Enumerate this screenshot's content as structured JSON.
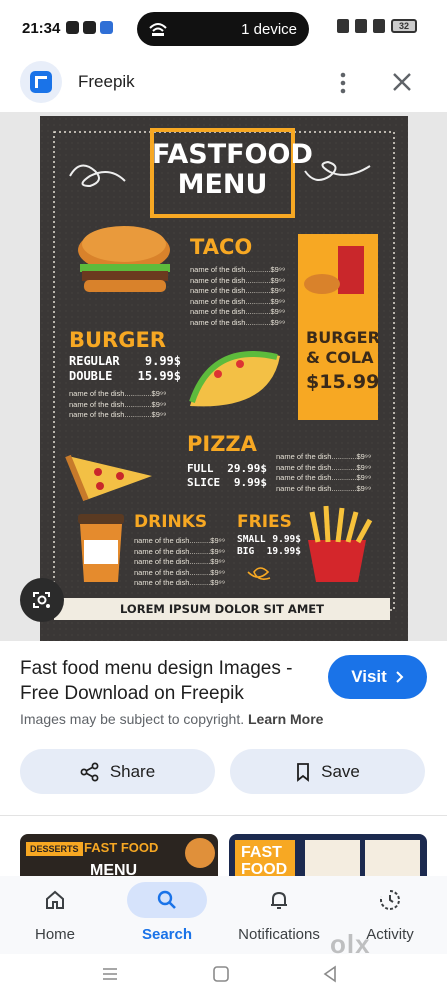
{
  "status": {
    "time": "21:34",
    "pill_text": "1 device",
    "battery": "32"
  },
  "source": {
    "name": "Freepik"
  },
  "menu_image": {
    "title_line1": "FASTFOOD",
    "title_line2": "MENU",
    "taco": {
      "heading": "TACO",
      "items": [
        "name of the dish............$9⁹⁹",
        "name of the dish............$9⁹⁹",
        "name of the dish............$9⁹⁹",
        "name of the dish............$9⁹⁹",
        "name of the dish............$9⁹⁹",
        "name of the dish............$9⁹⁹"
      ]
    },
    "burger": {
      "heading": "BURGER",
      "regular": "REGULAR",
      "regular_price": "9.99$",
      "double": "DOUBLE",
      "double_price": "15.99$",
      "items": [
        "name of the dish.............$9⁹⁹",
        "name of the dish.............$9⁹⁹",
        "name of the dish.............$9⁹⁹"
      ]
    },
    "combo": {
      "line1": "BURGER",
      "line2": "& COLA",
      "price": "$15.99"
    },
    "pizza": {
      "heading": "PIZZA",
      "full": "FULL",
      "full_price": "29.99$",
      "slice": "SLICE",
      "slice_price": "9.99$",
      "items": [
        "name of the dish............$9⁹⁹",
        "name of the dish............$9⁹⁹",
        "name of the dish............$9⁹⁹",
        "name of the dish............$9⁹⁹"
      ]
    },
    "drinks": {
      "heading": "DRINKS",
      "items": [
        "name of the dish..........$9⁹⁹",
        "name of the dish..........$9⁹⁹",
        "name of the dish..........$9⁹⁹",
        "name of the dish..........$9⁹⁹",
        "name of the dish..........$9⁹⁹"
      ]
    },
    "fries": {
      "heading": "FRIES",
      "small": "SMALL",
      "small_price": "9.99$",
      "big": "BIG",
      "big_price": "19.99$"
    },
    "footer": "LOREM IPSUM DOLOR SIT AMET"
  },
  "result": {
    "title": "Fast food menu design Images - Free Download on Freepik",
    "visit_label": "Visit",
    "copyright_text": "Images may be subject to copyright.",
    "learn_more": "Learn More",
    "share_label": "Share",
    "save_label": "Save"
  },
  "thumbs": {
    "thumb1_a": "DESSERTS",
    "thumb1_b": "FAST FOOD",
    "thumb1_c": "MENU",
    "thumb2_a": "FAST",
    "thumb2_b": "FOOD"
  },
  "nav": {
    "home": "Home",
    "search": "Search",
    "notifications": "Notifications",
    "activity": "Activity"
  },
  "watermark": "olx",
  "colors": {
    "accent": "#1a73e8",
    "menu_orange": "#f7a823",
    "menu_bg": "#3a3736"
  }
}
